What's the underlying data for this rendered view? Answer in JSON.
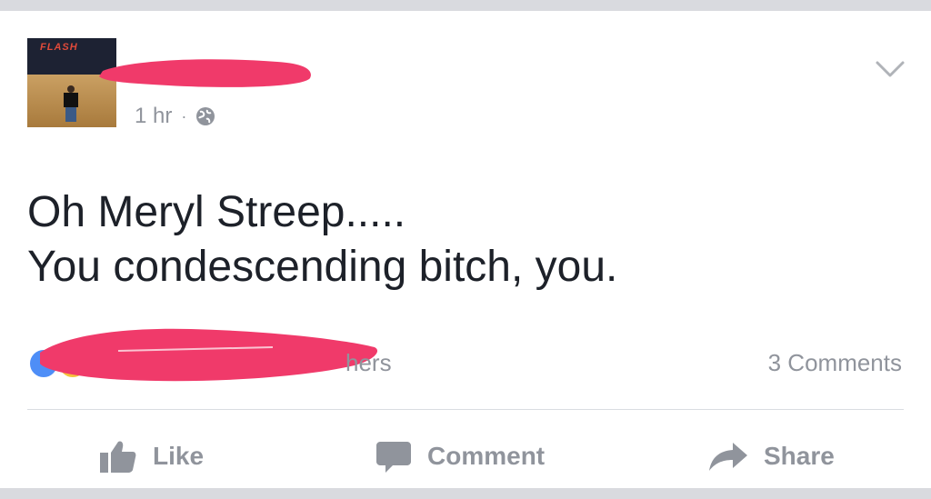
{
  "post": {
    "avatar_banner_text": "FLASH",
    "timestamp": "1 hr",
    "separator": "·",
    "privacy_icon": "globe-icon",
    "menu_icon": "chevron-down-icon",
    "text_line1": "Oh Meryl Streep.....",
    "text_line2": "You condescending bitch, you."
  },
  "reactions": {
    "icons": [
      "like-reaction-icon",
      "haha-reaction-icon"
    ],
    "others_text": "hers",
    "comments_text": "3 Comments"
  },
  "actions": {
    "like_label": "Like",
    "comment_label": "Comment",
    "share_label": "Share"
  },
  "colors": {
    "redaction": "#f03a6a",
    "muted_text": "#90949c",
    "body_text": "#1d2129",
    "like_blue": "#4e8ef7",
    "haha_yellow": "#f5c33b"
  }
}
